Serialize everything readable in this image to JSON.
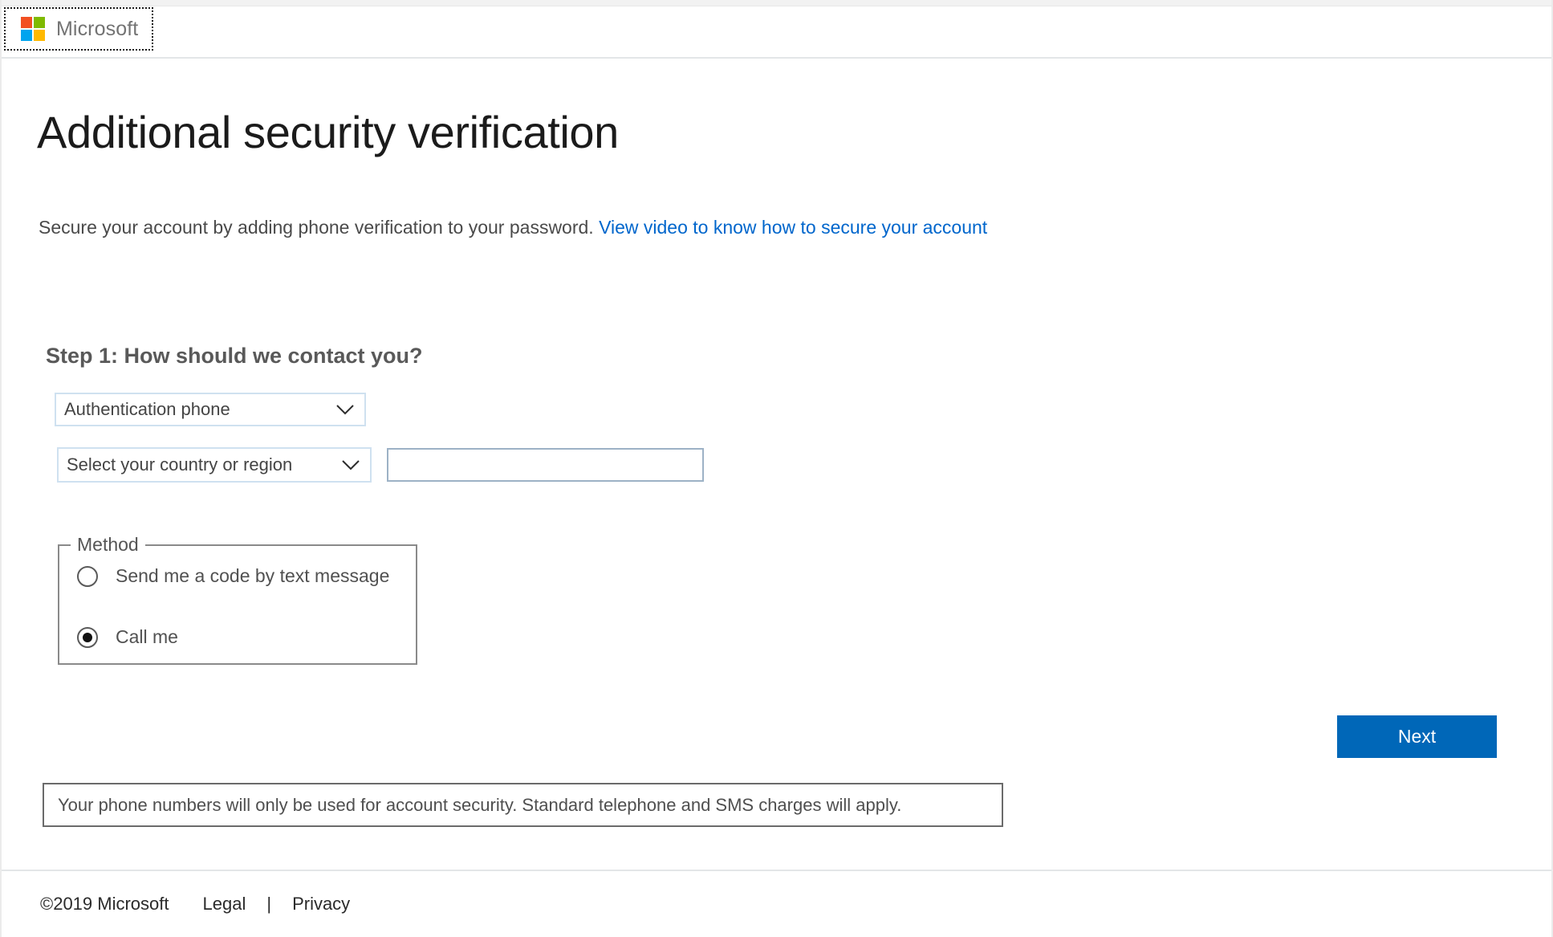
{
  "header": {
    "brand_name": "Microsoft",
    "logo_colors": {
      "top_left": "#f25022",
      "top_right": "#7fba00",
      "bottom_left": "#00a4ef",
      "bottom_right": "#ffb900"
    }
  },
  "main": {
    "title": "Additional security verification",
    "subtitle_text": "Secure your account by adding phone verification to your password.",
    "subtitle_link": "View video to know how to secure your account",
    "step_title": "Step 1: How should we contact you?",
    "auth_method_select": {
      "value": "Authentication phone",
      "icon": "chevron-down-icon"
    },
    "country_select": {
      "value": "Select your country or region",
      "icon": "chevron-down-icon"
    },
    "phone_input": {
      "value": "",
      "placeholder": ""
    },
    "method_fieldset": {
      "legend": "Method",
      "options": [
        {
          "label": "Send me a code by text message",
          "checked": false
        },
        {
          "label": "Call me",
          "checked": true
        }
      ]
    },
    "next_button": "Next",
    "info_text": "Your phone numbers will only be used for account security. Standard telephone and SMS charges will apply."
  },
  "footer": {
    "copyright": "©2019 Microsoft",
    "legal": "Legal",
    "separator": "|",
    "privacy": "Privacy"
  },
  "colors": {
    "accent_blue": "#0067b8",
    "link_blue": "#0066cc",
    "field_border_blue": "#cfe1f0",
    "input_border": "#9db2c6",
    "fieldset_border": "#8a8a8a"
  }
}
